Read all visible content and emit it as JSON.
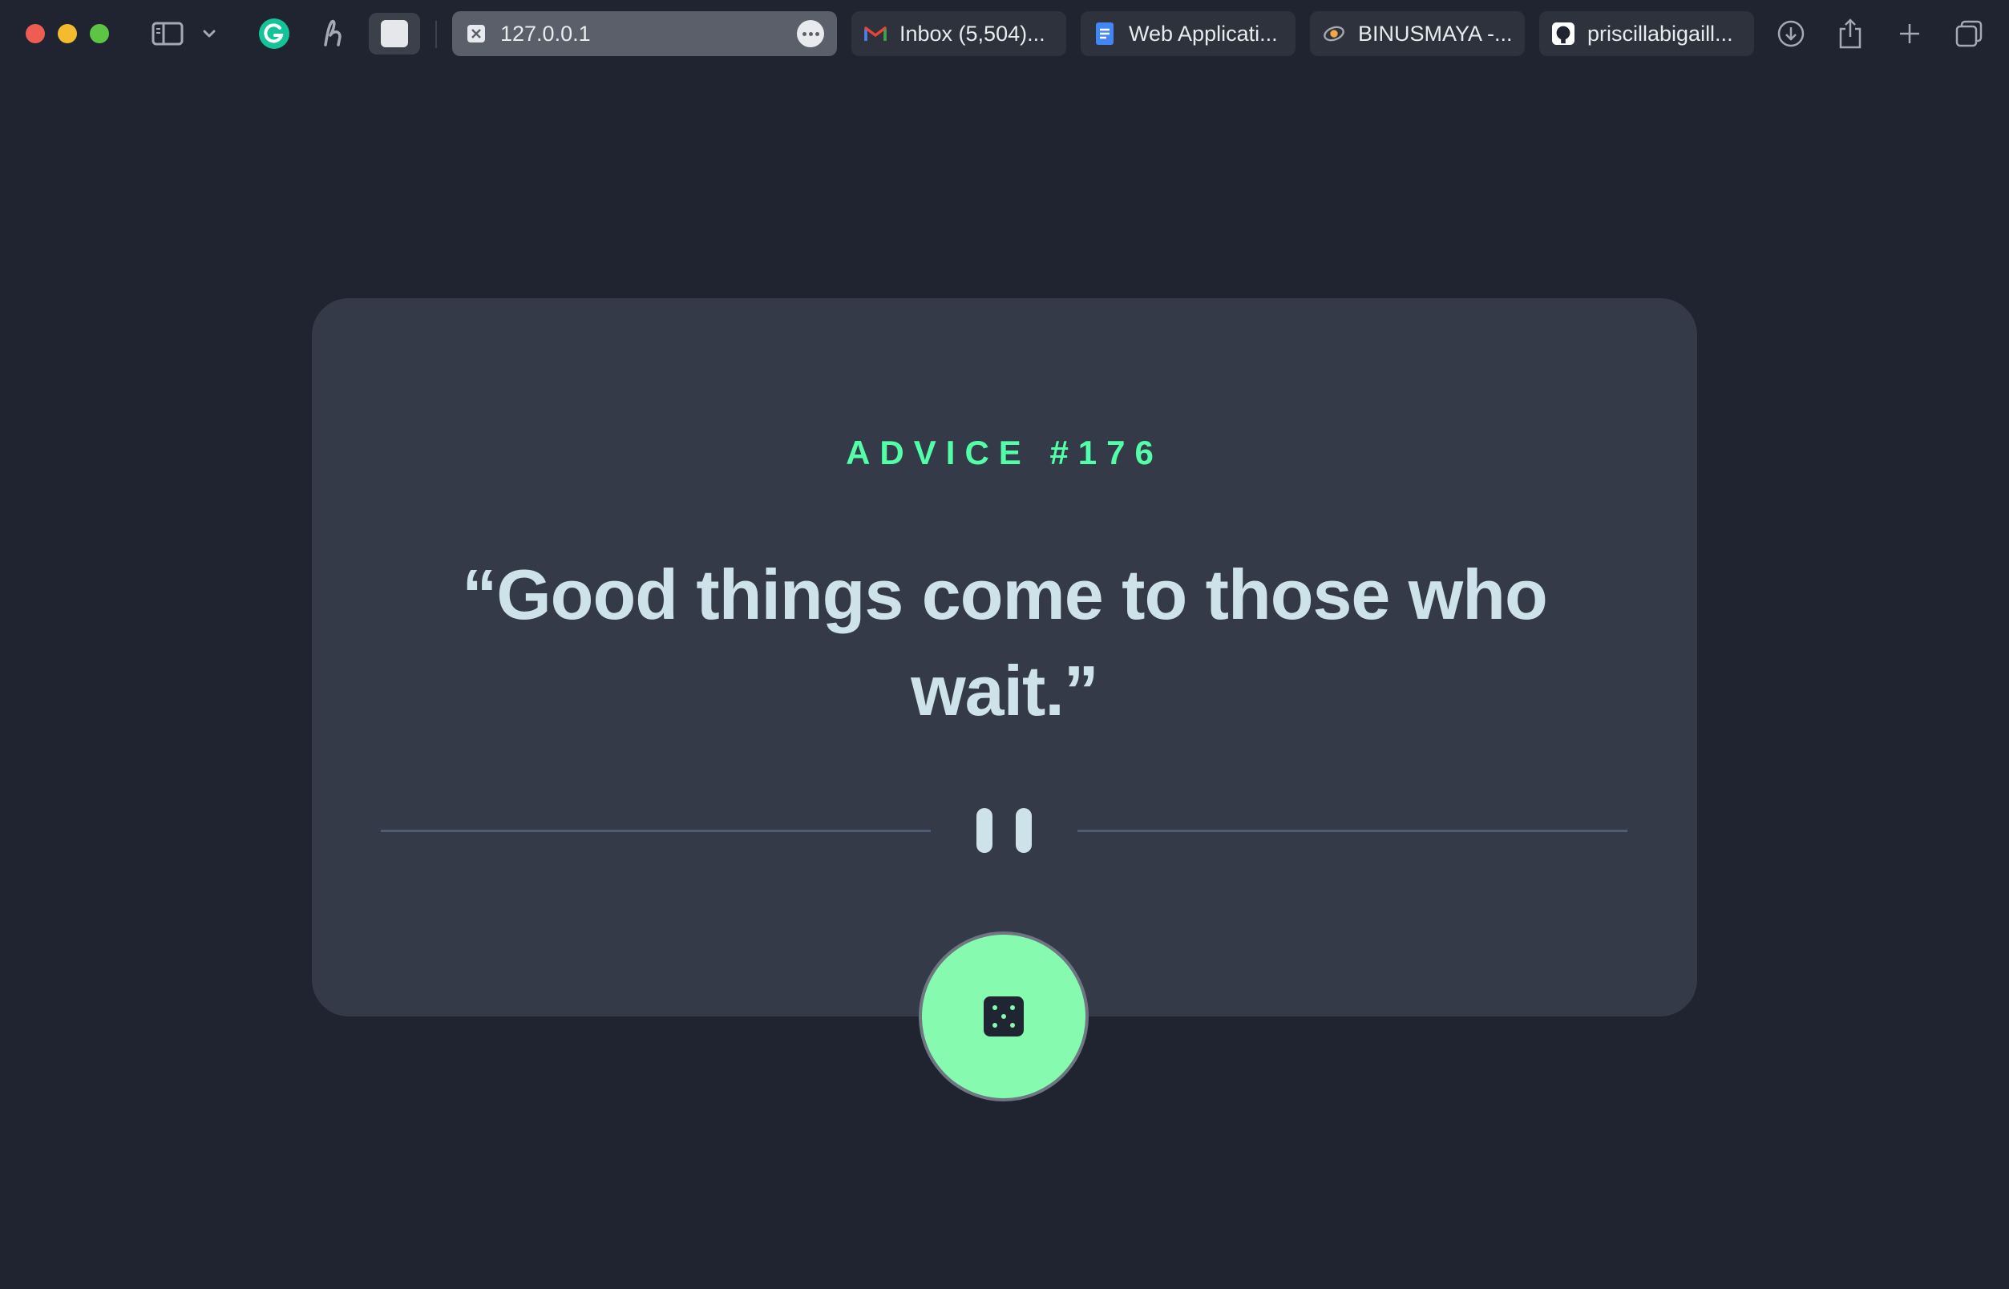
{
  "browser": {
    "active_tab": {
      "title": "127.0.0.1"
    },
    "tabs": [
      {
        "title": "Inbox (5,504)...",
        "favicon": "gmail-icon"
      },
      {
        "title": "Web Applicati...",
        "favicon": "google-docs-icon"
      },
      {
        "title": "BINUSMAYA -...",
        "favicon": "binusmaya-icon"
      },
      {
        "title": "priscillabigaill...",
        "favicon": "github-icon"
      }
    ],
    "extensions": [
      "grammarly-icon",
      "honey-icon",
      "extension-icon"
    ],
    "toolbar_icons": [
      "download-icon",
      "share-icon",
      "new-tab-icon",
      "tab-overview-icon"
    ]
  },
  "advice": {
    "heading": "ADVICE #176",
    "quote": "“Good things come to those who wait.”"
  },
  "colors": {
    "background": "#1f2430",
    "card": "#343a48",
    "accent": "#52ffa8",
    "button": "#86fbb0",
    "quote_text": "#cee3e9"
  }
}
